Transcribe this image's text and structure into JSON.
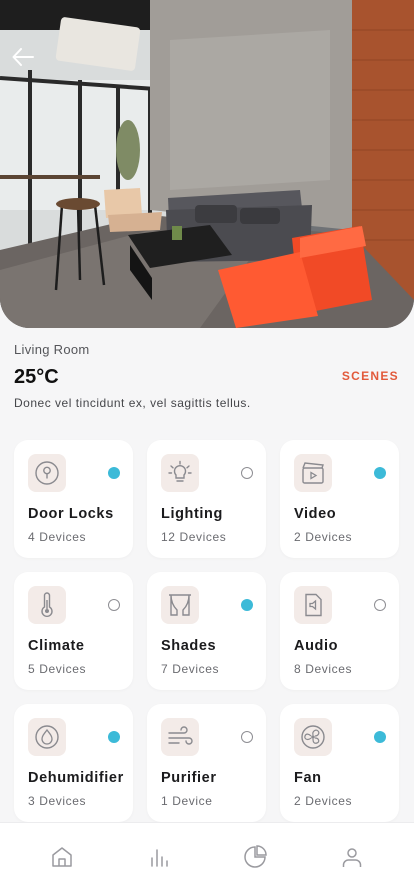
{
  "room": {
    "name": "Living Room",
    "temperature": "25°C",
    "scenes_label": "SCENES",
    "description": "Donec vel tincidunt ex, vel sagittis tellus."
  },
  "devices": [
    {
      "title": "Door Locks",
      "count": "4 Devices",
      "icon": "lock-icon",
      "on": true
    },
    {
      "title": "Lighting",
      "count": "12 Devices",
      "icon": "lightbulb-icon",
      "on": false
    },
    {
      "title": "Video",
      "count": "2 Devices",
      "icon": "video-icon",
      "on": true
    },
    {
      "title": "Climate",
      "count": "5 Devices",
      "icon": "thermometer-icon",
      "on": false
    },
    {
      "title": "Shades",
      "count": "7 Devices",
      "icon": "curtains-icon",
      "on": true
    },
    {
      "title": "Audio",
      "count": "8 Devices",
      "icon": "speaker-icon",
      "on": false
    },
    {
      "title": "Dehumidifier",
      "count": "3 Devices",
      "icon": "droplet-icon",
      "on": true
    },
    {
      "title": "Purifier",
      "count": "1 Device",
      "icon": "wind-icon",
      "on": false
    },
    {
      "title": "Fan",
      "count": "2 Devices",
      "icon": "fan-icon",
      "on": true
    }
  ],
  "tabbar": [
    "home-icon",
    "stats-icon",
    "pie-chart-icon",
    "profile-icon"
  ],
  "colors": {
    "accent": "#e25a3b",
    "active_dot": "#3cbad8",
    "icon_bg": "#f3ebe8"
  }
}
